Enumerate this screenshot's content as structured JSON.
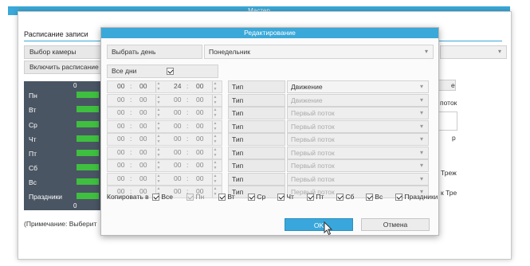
{
  "background": {
    "window_title": "Мастер",
    "tab": "Расписание записи",
    "rows": [
      "Выбор камеры",
      "Включить расписание"
    ],
    "days": [
      "Пн",
      "Вт",
      "Ср",
      "Чт",
      "Пт",
      "Сб",
      "Вс",
      "Праздники"
    ],
    "scale_start_top": "0",
    "scale_start_bottom": "0",
    "note": "(Примечание: Выберит",
    "right_texts": [
      "e",
      "поток",
      "Треж",
      "к Тре",
      "р"
    ]
  },
  "modal": {
    "title": "Редактирование",
    "day_label": "Выбрать день",
    "day_value": "Понедельник",
    "all_days_label": "Все дни",
    "all_days_checked": true,
    "time_rows": [
      {
        "h1": "00",
        "m1": "00",
        "h2": "24",
        "m2": "00",
        "type_label": "Тип",
        "type_value": "Движение",
        "active": true
      },
      {
        "h1": "00",
        "m1": "00",
        "h2": "00",
        "m2": "00",
        "type_label": "Тип",
        "type_value": "Движение",
        "active": false
      },
      {
        "h1": "00",
        "m1": "00",
        "h2": "00",
        "m2": "00",
        "type_label": "Тип",
        "type_value": "Первый поток",
        "active": false
      },
      {
        "h1": "00",
        "m1": "00",
        "h2": "00",
        "m2": "00",
        "type_label": "Тип",
        "type_value": "Первый поток",
        "active": false
      },
      {
        "h1": "00",
        "m1": "00",
        "h2": "00",
        "m2": "00",
        "type_label": "Тип",
        "type_value": "Первый поток",
        "active": false
      },
      {
        "h1": "00",
        "m1": "00",
        "h2": "00",
        "m2": "00",
        "type_label": "Тип",
        "type_value": "Первый поток",
        "active": false
      },
      {
        "h1": "00",
        "m1": "00",
        "h2": "00",
        "m2": "00",
        "type_label": "Тип",
        "type_value": "Первый поток",
        "active": false
      },
      {
        "h1": "00",
        "m1": "00",
        "h2": "00",
        "m2": "00",
        "type_label": "Тип",
        "type_value": "Первый поток",
        "active": false
      },
      {
        "h1": "00",
        "m1": "00",
        "h2": "00",
        "m2": "00",
        "type_label": "Тип",
        "type_value": "Первый поток",
        "active": false
      }
    ],
    "copy_label": "Копировать в",
    "copy_options": [
      {
        "label": "Все",
        "checked": true,
        "disabled": false
      },
      {
        "label": "Пн",
        "checked": true,
        "disabled": true
      },
      {
        "label": "Вт",
        "checked": true,
        "disabled": false
      },
      {
        "label": "Ср",
        "checked": true,
        "disabled": false
      },
      {
        "label": "Чт",
        "checked": true,
        "disabled": false
      },
      {
        "label": "Пт",
        "checked": true,
        "disabled": false
      },
      {
        "label": "Сб",
        "checked": true,
        "disabled": false
      },
      {
        "label": "Вс",
        "checked": true,
        "disabled": false
      },
      {
        "label": "Праздники",
        "checked": true,
        "disabled": false
      }
    ],
    "ok_label": "OK",
    "cancel_label": "Отмена"
  },
  "colors": {
    "accent": "#3aa8d8",
    "bar_green": "#3fbf3f",
    "dark_panel": "#4a5563"
  }
}
